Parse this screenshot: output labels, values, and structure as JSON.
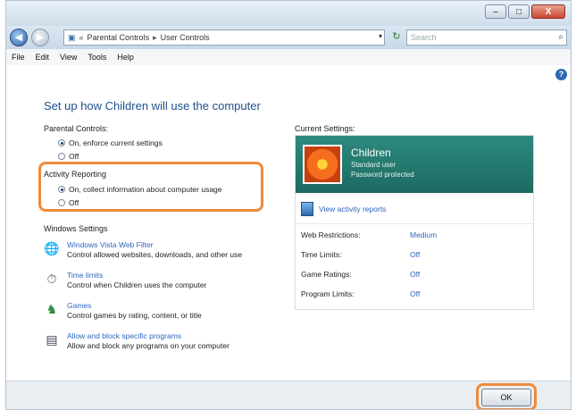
{
  "window": {
    "controls": {
      "minimize": "–",
      "maximize": "□",
      "close": "X"
    }
  },
  "navbar": {
    "breadcrumb": [
      "Parental Controls",
      "User Controls"
    ],
    "search_placeholder": "Search"
  },
  "menu": [
    "File",
    "Edit",
    "View",
    "Tools",
    "Help"
  ],
  "heading": "Set up how Children will use the computer",
  "parental_controls": {
    "label": "Parental Controls:",
    "options": [
      {
        "label": "On, enforce current settings",
        "selected": true
      },
      {
        "label": "Off",
        "selected": false
      }
    ]
  },
  "activity_reporting": {
    "label": "Activity Reporting",
    "options": [
      {
        "label": "On, collect information about computer usage",
        "selected": true
      },
      {
        "label": "Off",
        "selected": false
      }
    ]
  },
  "windows_settings": {
    "label": "Windows Settings",
    "items": [
      {
        "title": "Windows Vista Web Filter",
        "desc": "Control allowed websites, downloads, and other use",
        "icon": "globe-icon"
      },
      {
        "title": "Time limits",
        "desc": "Control when Children uses the computer",
        "icon": "clock-icon"
      },
      {
        "title": "Games",
        "desc": "Control games by rating, content, or title",
        "icon": "game-icon"
      },
      {
        "title": "Allow and block specific programs",
        "desc": "Allow and block any programs on your computer",
        "icon": "programs-icon"
      }
    ]
  },
  "current_settings": {
    "label": "Current Settings:",
    "user_name": "Children",
    "user_type": "Standard user",
    "password_status": "Password protected",
    "view_reports": "View activity reports",
    "settings": [
      {
        "name": "Web Restrictions:",
        "value": "Medium"
      },
      {
        "name": "Time Limits:",
        "value": "Off"
      },
      {
        "name": "Game Ratings:",
        "value": "Off"
      },
      {
        "name": "Program Limits:",
        "value": "Off"
      }
    ]
  },
  "footer": {
    "ok_label": "OK"
  },
  "colors": {
    "highlight": "#f08a3a",
    "link": "#2f66c0",
    "panel_green": "#1c6a61"
  }
}
